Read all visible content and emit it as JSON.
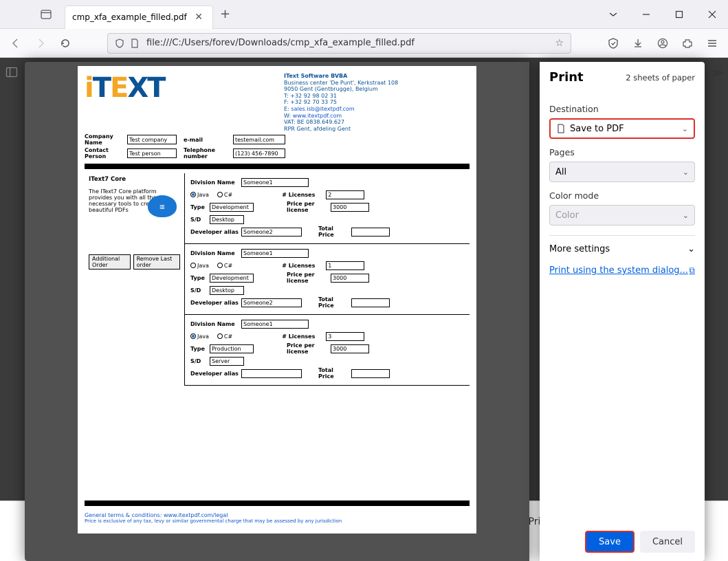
{
  "window": {
    "tab_title": "cmp_xfa_example_filled.pdf"
  },
  "toolbar": {
    "url": "file:///C:/Users/forev/Downloads/cmp_xfa_example_filled.pdf"
  },
  "document": {
    "company": {
      "name": "IText Software BVBA",
      "address1": "Business center 'De Punt', Kerkstraat 108",
      "address2": "9050 Gent (Gentbrugge), Belgium",
      "tel": "T: +32 92 98 02 31",
      "fax": "F: +32 92 70 33 75",
      "email_label": "E:",
      "email": "sales.isb@itextpdf.com",
      "web_label": "W:",
      "web": "www.itextpdf.com",
      "vat": "VAT: BE 0838.649.627",
      "rpr": "RPR Gent, afdeling Gent"
    },
    "header": {
      "company_name_label": "Company Name",
      "company_name": "Test company",
      "email_label": "e-mail",
      "email": "testemail.com",
      "contact_label": "Contact Person",
      "contact": "Test person",
      "phone_label": "Telephone number",
      "phone": "(123) 456-7890"
    },
    "core": {
      "title": "IText7 Core",
      "desc": "The IText7 Core platform provides you with all the necessary tools to create beautiful PDFs",
      "btn_add": "Additional Order",
      "btn_remove": "Remove Last order"
    },
    "labels": {
      "division": "Division Name",
      "java": "Java",
      "csharp": "C#",
      "licenses": "# Licenses",
      "type": "Type",
      "ppl": "Price per license",
      "sd": "S/D",
      "dev_alias": "Developer alias",
      "total": "Total Price"
    },
    "divisions": [
      {
        "name": "Someone1",
        "java": true,
        "licenses": "2",
        "type": "Development",
        "ppl": "3000",
        "sd": "Desktop",
        "alias": "Someone2"
      },
      {
        "name": "Someone1",
        "java": false,
        "licenses": "1",
        "type": "Development",
        "ppl": "3000",
        "sd": "Desktop",
        "alias": "Someone2"
      },
      {
        "name": "Someone1",
        "java": true,
        "licenses": "3",
        "type": "Production",
        "ppl": "3000",
        "sd": "Server",
        "alias": ""
      }
    ],
    "footer": {
      "terms": "General terms & conditions: www.itextpdf.com/legal",
      "price_note": "Price is exclusive of any tax, levy or similar governmental charge that may be assessed by any jurisdiction"
    }
  },
  "print": {
    "title": "Print",
    "sheets": "2 sheets of paper",
    "dest_label": "Destination",
    "dest_value": "Save to PDF",
    "pages_label": "Pages",
    "pages_value": "All",
    "color_label": "Color mode",
    "color_value": "Color",
    "more": "More settings",
    "system_link": "Print using the system dialog...",
    "save": "Save",
    "cancel": "Cancel"
  },
  "bg": {
    "dev_alias": "Developer alias",
    "alias_val": "Someone2",
    "total": "Total Price"
  }
}
